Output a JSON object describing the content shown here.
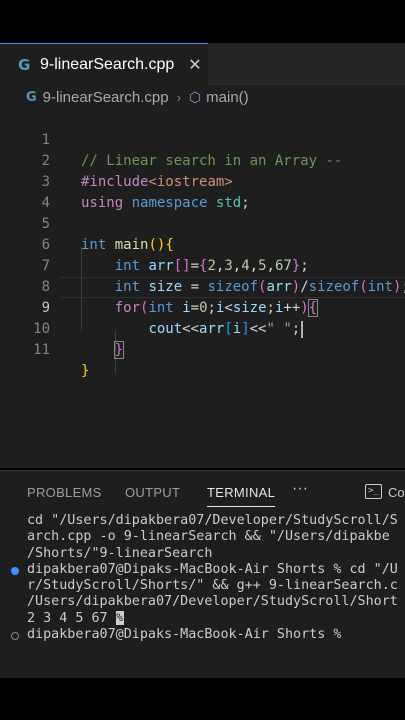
{
  "tab": {
    "icon": "cpp-file-icon",
    "title": "9-linearSearch.cpp",
    "close": "✕"
  },
  "breadcrumb": {
    "file": "9-linearSearch.cpp",
    "separator": "›",
    "symbol_icon": "symbol-method-icon",
    "symbol": "main()"
  },
  "code": {
    "active_line": 9,
    "lines": [
      {
        "n": "1",
        "text": "// Linear search in an Array --"
      },
      {
        "n": "2",
        "text": "#include<iostream>"
      },
      {
        "n": "3",
        "text": "using namespace std;"
      },
      {
        "n": "4",
        "text": ""
      },
      {
        "n": "5",
        "text": "int main(){"
      },
      {
        "n": "6",
        "text": "    int arr[]={2,3,4,5,67};"
      },
      {
        "n": "7",
        "text": "    int size = sizeof(arr)/sizeof(int);"
      },
      {
        "n": "8",
        "text": "    for(int i=0;i<size;i++){"
      },
      {
        "n": "9",
        "text": "        cout<<arr[i]<<\" \";"
      },
      {
        "n": "10",
        "text": "    }"
      },
      {
        "n": "11",
        "text": "}"
      }
    ]
  },
  "panel": {
    "tabs": [
      "PROBLEMS",
      "OUTPUT",
      "TERMINAL"
    ],
    "active_tab": "TERMINAL",
    "more": "···",
    "terminal_label": "Co"
  },
  "terminal": {
    "lines": [
      "cd \"/Users/dipakbera07/Developer/StudyScroll/S",
      "arch.cpp -o 9-linearSearch && \"/Users/dipakbe",
      "/Shorts/\"9-linearSearch",
      "dipakbera07@Dipaks-MacBook-Air Shorts % cd \"/U",
      "r/StudyScroll/Shorts/\" && g++ 9-linearSearch.c",
      "/Users/dipakbera07/Developer/StudyScroll/Short",
      "2 3 4 5 67 ",
      "dipakbera07@Dipaks-MacBook-Air Shorts % "
    ],
    "output_end_marker": "%"
  },
  "colors": {
    "editor_bg": "#1e1e1e",
    "keyword": "#569cd6",
    "comment": "#6a9955",
    "string": "#ce9178",
    "number": "#b5cea8",
    "function": "#dcdcaa",
    "variable": "#9cdcfe",
    "control": "#c586c0",
    "accent": "#3794ff"
  }
}
